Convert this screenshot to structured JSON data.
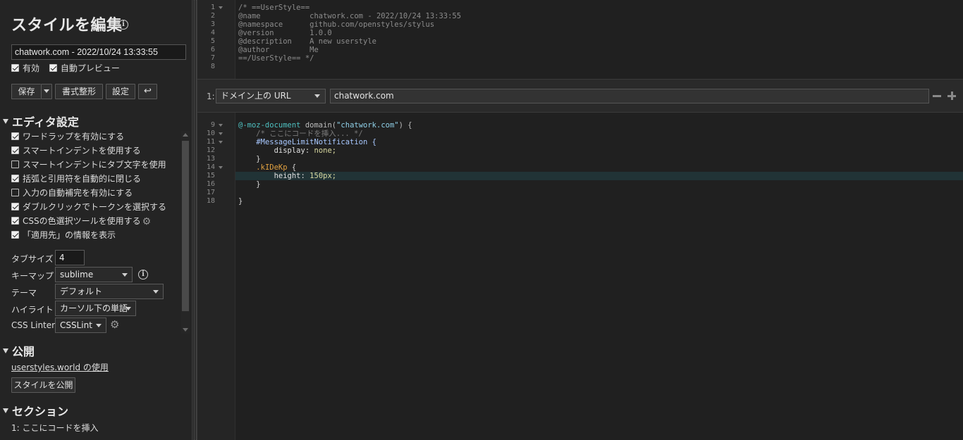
{
  "sidebar": {
    "title": "スタイルを編集",
    "name_value": "chatwork.com - 2022/10/24 13:33:55",
    "enabled_label": "有効",
    "live_preview_label": "自動プレビュー",
    "buttons": {
      "save": "保存",
      "format": "書式整形",
      "settings": "設定",
      "undo": "↩"
    },
    "editor_settings": {
      "heading": "エディタ設定",
      "options": [
        {
          "label": "ワードラップを有効にする",
          "checked": true
        },
        {
          "label": "スマートインデントを使用する",
          "checked": true
        },
        {
          "label": "スマートインデントにタブ文字を使用",
          "checked": false
        },
        {
          "label": "括弧と引用符を自動的に閉じる",
          "checked": true
        },
        {
          "label": "入力の自動補完を有効にする",
          "checked": false
        },
        {
          "label": "ダブルクリックでトークンを選択する",
          "checked": true
        },
        {
          "label": "CSSの色選択ツールを使用する",
          "checked": true
        },
        {
          "label": "「適用先」の情報を表示",
          "checked": true
        }
      ],
      "tab_size_label": "タブサイズ",
      "tab_size_value": "4",
      "keymap_label": "キーマップ",
      "keymap_value": "sublime",
      "theme_label": "テーマ",
      "theme_value": "デフォルト",
      "highlight_label": "ハイライト",
      "highlight_value": "カーソル下の単語",
      "linter_label": "CSS Linter",
      "linter_value": "CSSLint"
    },
    "publish": {
      "heading": "公開",
      "link": "userstyles.world の使用",
      "button": "スタイルを公開"
    },
    "sections": {
      "heading": "セクション",
      "items": [
        "1: ここにコードを挿入"
      ]
    }
  },
  "editor": {
    "meta_block": {
      "line_numbers": [
        "1",
        "2",
        "3",
        "4",
        "5",
        "6",
        "7",
        "8"
      ],
      "lines": [
        "/* ==UserStyle==",
        "@name           chatwork.com - 2022/10/24 13:33:55",
        "@namespace      github.com/openstyles/stylus",
        "@version        1.0.0",
        "@description    A new userstyle",
        "@author         Me",
        "==/UserStyle== */",
        ""
      ]
    },
    "applies_to": {
      "index": "1:",
      "type": "ドメイン上の URL",
      "value": "chatwork.com"
    },
    "code_block": {
      "line_numbers": [
        "9",
        "10",
        "11",
        "12",
        "13",
        "14",
        "15",
        "16",
        "17",
        "18"
      ],
      "at_rule": "@-moz-document",
      "domain_fn": "domain(",
      "domain_str": "\"chatwork.com\"",
      "domain_close": ") {",
      "comment": "/* ここにコードを挿入... */",
      "selector1": "#MessageLimitNotification {",
      "prop1": "display",
      "val1": "none;",
      "close1": "}",
      "selector2": ".kIDeKp",
      "selector2_brace": " {",
      "prop2": "height",
      "val2": "150px;",
      "close2": "}",
      "close_doc": "}"
    }
  },
  "colors": {
    "background": "#1e1e1e",
    "sidebar": "#242424",
    "highlight_line": "#213336"
  }
}
